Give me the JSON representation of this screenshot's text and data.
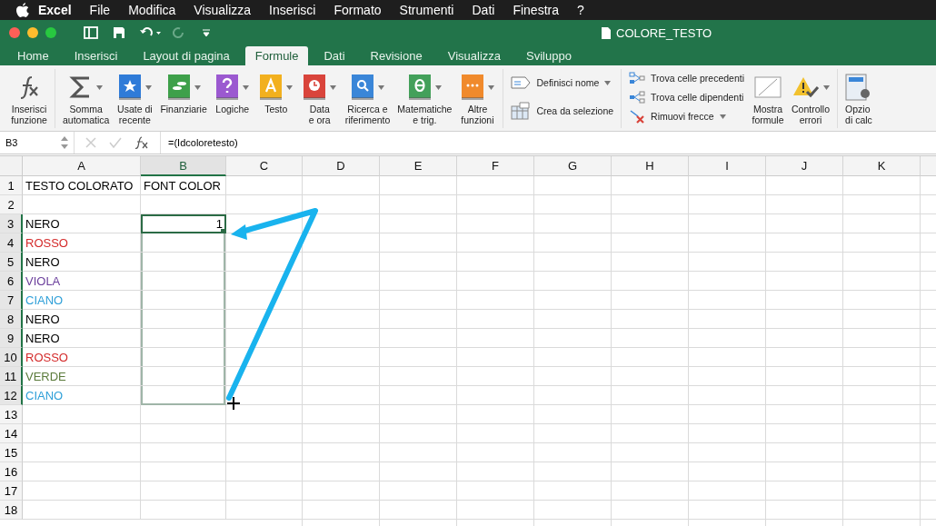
{
  "menu_bar": {
    "items": [
      {
        "label": "Excel",
        "kind": "app"
      },
      {
        "label": "File",
        "kind": "menu"
      },
      {
        "label": "Modifica",
        "kind": "menu"
      },
      {
        "label": "Visualizza",
        "kind": "menu"
      },
      {
        "label": "Inserisci",
        "kind": "menu"
      },
      {
        "label": "Formato",
        "kind": "menu"
      },
      {
        "label": "Strumenti",
        "kind": "menu"
      },
      {
        "label": "Dati",
        "kind": "menu"
      },
      {
        "label": "Finestra",
        "kind": "menu"
      },
      {
        "label": "?",
        "kind": "menu"
      }
    ]
  },
  "window": {
    "title": "COLORE_TESTO"
  },
  "ribbon_tabs": [
    {
      "label": "Home",
      "selected": false
    },
    {
      "label": "Inserisci",
      "selected": false
    },
    {
      "label": "Layout di pagina",
      "selected": false
    },
    {
      "label": "Formule",
      "selected": true
    },
    {
      "label": "Dati",
      "selected": false
    },
    {
      "label": "Revisione",
      "selected": false
    },
    {
      "label": "Visualizza",
      "selected": false
    },
    {
      "label": "Sviluppo",
      "selected": false
    }
  ],
  "ribbon": {
    "function_buttons": [
      {
        "label": "Inserisci\nfunzione",
        "dropdown": false
      },
      {
        "label": "Somma\nautomatica",
        "dropdown": true
      },
      {
        "label": "Usate di\nrecente",
        "dropdown": true
      },
      {
        "label": "Finanziarie",
        "dropdown": true
      },
      {
        "label": "Logiche",
        "dropdown": true
      },
      {
        "label": "Testo",
        "dropdown": true
      },
      {
        "label": "Data\ne ora",
        "dropdown": true
      },
      {
        "label": "Ricerca e\nriferimento",
        "dropdown": true
      },
      {
        "label": "Matematiche\ne trig.",
        "dropdown": true
      },
      {
        "label": "Altre\nfunzioni",
        "dropdown": true
      }
    ],
    "name_buttons": [
      {
        "label": "Definisci nome",
        "dropdown": true
      },
      {
        "label": "Crea da selezione",
        "dropdown": false
      }
    ],
    "audit_buttons": [
      {
        "label": "Trova celle precedenti",
        "dropdown": false
      },
      {
        "label": "Trova celle dipendenti",
        "dropdown": false
      },
      {
        "label": "Rimuovi frecce",
        "dropdown": true
      }
    ],
    "check_buttons": [
      {
        "label": "Mostra\nformule",
        "dropdown": false
      },
      {
        "label": "Controllo\nerrori",
        "dropdown": true
      }
    ],
    "calc_button": {
      "label": "Opzio\ndi calc"
    }
  },
  "formula_bar": {
    "name_box": "B3",
    "formula": "=(Idcoloretesto)"
  },
  "sheet": {
    "columns": [
      {
        "label": "A",
        "selected": false
      },
      {
        "label": "B",
        "selected": true
      },
      {
        "label": "C",
        "selected": false
      },
      {
        "label": "D",
        "selected": false
      },
      {
        "label": "E",
        "selected": false
      },
      {
        "label": "F",
        "selected": false
      },
      {
        "label": "G",
        "selected": false
      },
      {
        "label": "H",
        "selected": false
      },
      {
        "label": "I",
        "selected": false
      },
      {
        "label": "J",
        "selected": false
      },
      {
        "label": "K",
        "selected": false
      }
    ],
    "rows": [
      {
        "label": "1",
        "a": {
          "text": "TESTO COLORATO",
          "color": "#000000"
        },
        "b": "FONT COLOR",
        "active": false,
        "in_selection": false
      },
      {
        "label": "2",
        "active": false,
        "in_selection": false
      },
      {
        "label": "3",
        "a": {
          "text": "NERO",
          "color": "#000000"
        },
        "b": "1",
        "active": true,
        "in_selection": true
      },
      {
        "label": "4",
        "a": {
          "text": "ROSSO",
          "color": "#d42a2a"
        },
        "active": false,
        "in_selection": true
      },
      {
        "label": "5",
        "a": {
          "text": "NERO",
          "color": "#000000"
        },
        "active": false,
        "in_selection": true
      },
      {
        "label": "6",
        "a": {
          "text": "VIOLA",
          "color": "#6b3f9c"
        },
        "active": false,
        "in_selection": true
      },
      {
        "label": "7",
        "a": {
          "text": "CIANO",
          "color": "#2e9fd8"
        },
        "active": false,
        "in_selection": true
      },
      {
        "label": "8",
        "a": {
          "text": "NERO",
          "color": "#000000"
        },
        "active": false,
        "in_selection": true
      },
      {
        "label": "9",
        "a": {
          "text": "NERO",
          "color": "#000000"
        },
        "active": false,
        "in_selection": true
      },
      {
        "label": "10",
        "a": {
          "text": "ROSSO",
          "color": "#d42a2a"
        },
        "active": false,
        "in_selection": true
      },
      {
        "label": "11",
        "a": {
          "text": "VERDE",
          "color": "#5b7b3b"
        },
        "active": false,
        "in_selection": true
      },
      {
        "label": "12",
        "a": {
          "text": "CIANO",
          "color": "#2e9fd8"
        },
        "active": false,
        "in_selection": true
      },
      {
        "label": "13",
        "active": false,
        "in_selection": false
      },
      {
        "label": "14",
        "active": false,
        "in_selection": false
      },
      {
        "label": "15",
        "active": false,
        "in_selection": false
      },
      {
        "label": "16",
        "active": false,
        "in_selection": false
      },
      {
        "label": "17",
        "active": false,
        "in_selection": false
      },
      {
        "label": "18",
        "active": false,
        "in_selection": false
      }
    ]
  }
}
